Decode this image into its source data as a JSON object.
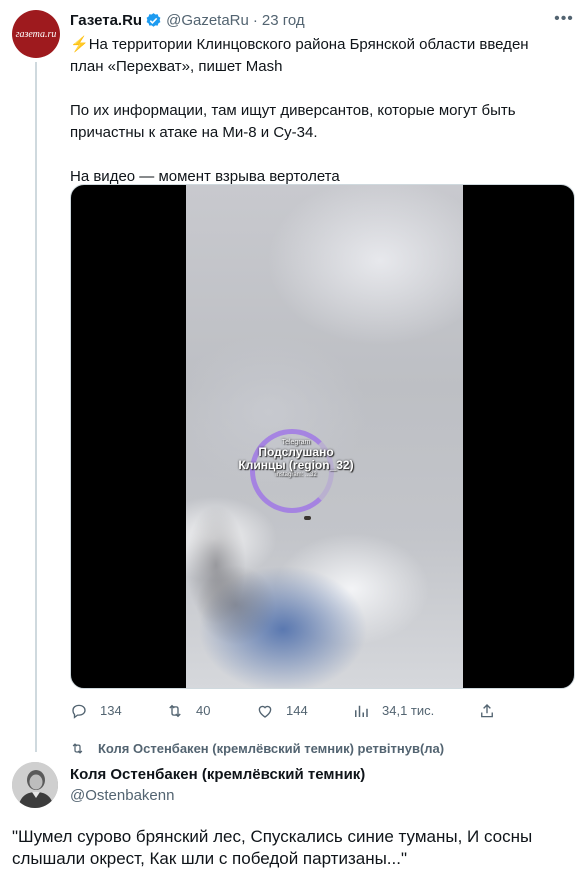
{
  "tweet1": {
    "avatar_text": "газета.ru",
    "author_name": "Газета.Ru",
    "handle": "@GazetaRu",
    "separator": "·",
    "time": "23 год",
    "bolt": "⚡",
    "line1": "На территории Клинцовского района Брянской области введен план «Перехват», пишет Mash",
    "line2": "По их информации, там ищут диверсантов, которые могут быть причастны к атаке на Ми-8 и Су-34.",
    "line3": "На видео — момент взрыва вертолета",
    "media": {
      "watermark_top": "Telegram",
      "watermark_main": "Подслушано Клинцы (region_32)",
      "watermark_bottom": "instagram: ...32"
    },
    "actions": {
      "reply_count": "134",
      "retweet_count": "40",
      "like_count": "144",
      "views_count": "34,1 тис."
    }
  },
  "retweet_notice": "Коля Остенбакен (кремлёвский темник) ретвітнув(ла)",
  "tweet2": {
    "author_name": "Коля Остенбакен (кремлёвский темник)",
    "handle": "@Ostenbakenn",
    "text": "\"Шумел сурово брянский лес, Спускались синие туманы, И сосны слышали окрест, Как шли с победой партизаны...\""
  },
  "colors": {
    "accent": "#1d9bf0",
    "secondary_text": "#536471",
    "gazeta_red": "#9e1a1e"
  },
  "icons": [
    "verified-badge-icon",
    "more-icon",
    "reply-icon",
    "retweet-icon",
    "like-icon",
    "views-icon",
    "share-icon"
  ]
}
